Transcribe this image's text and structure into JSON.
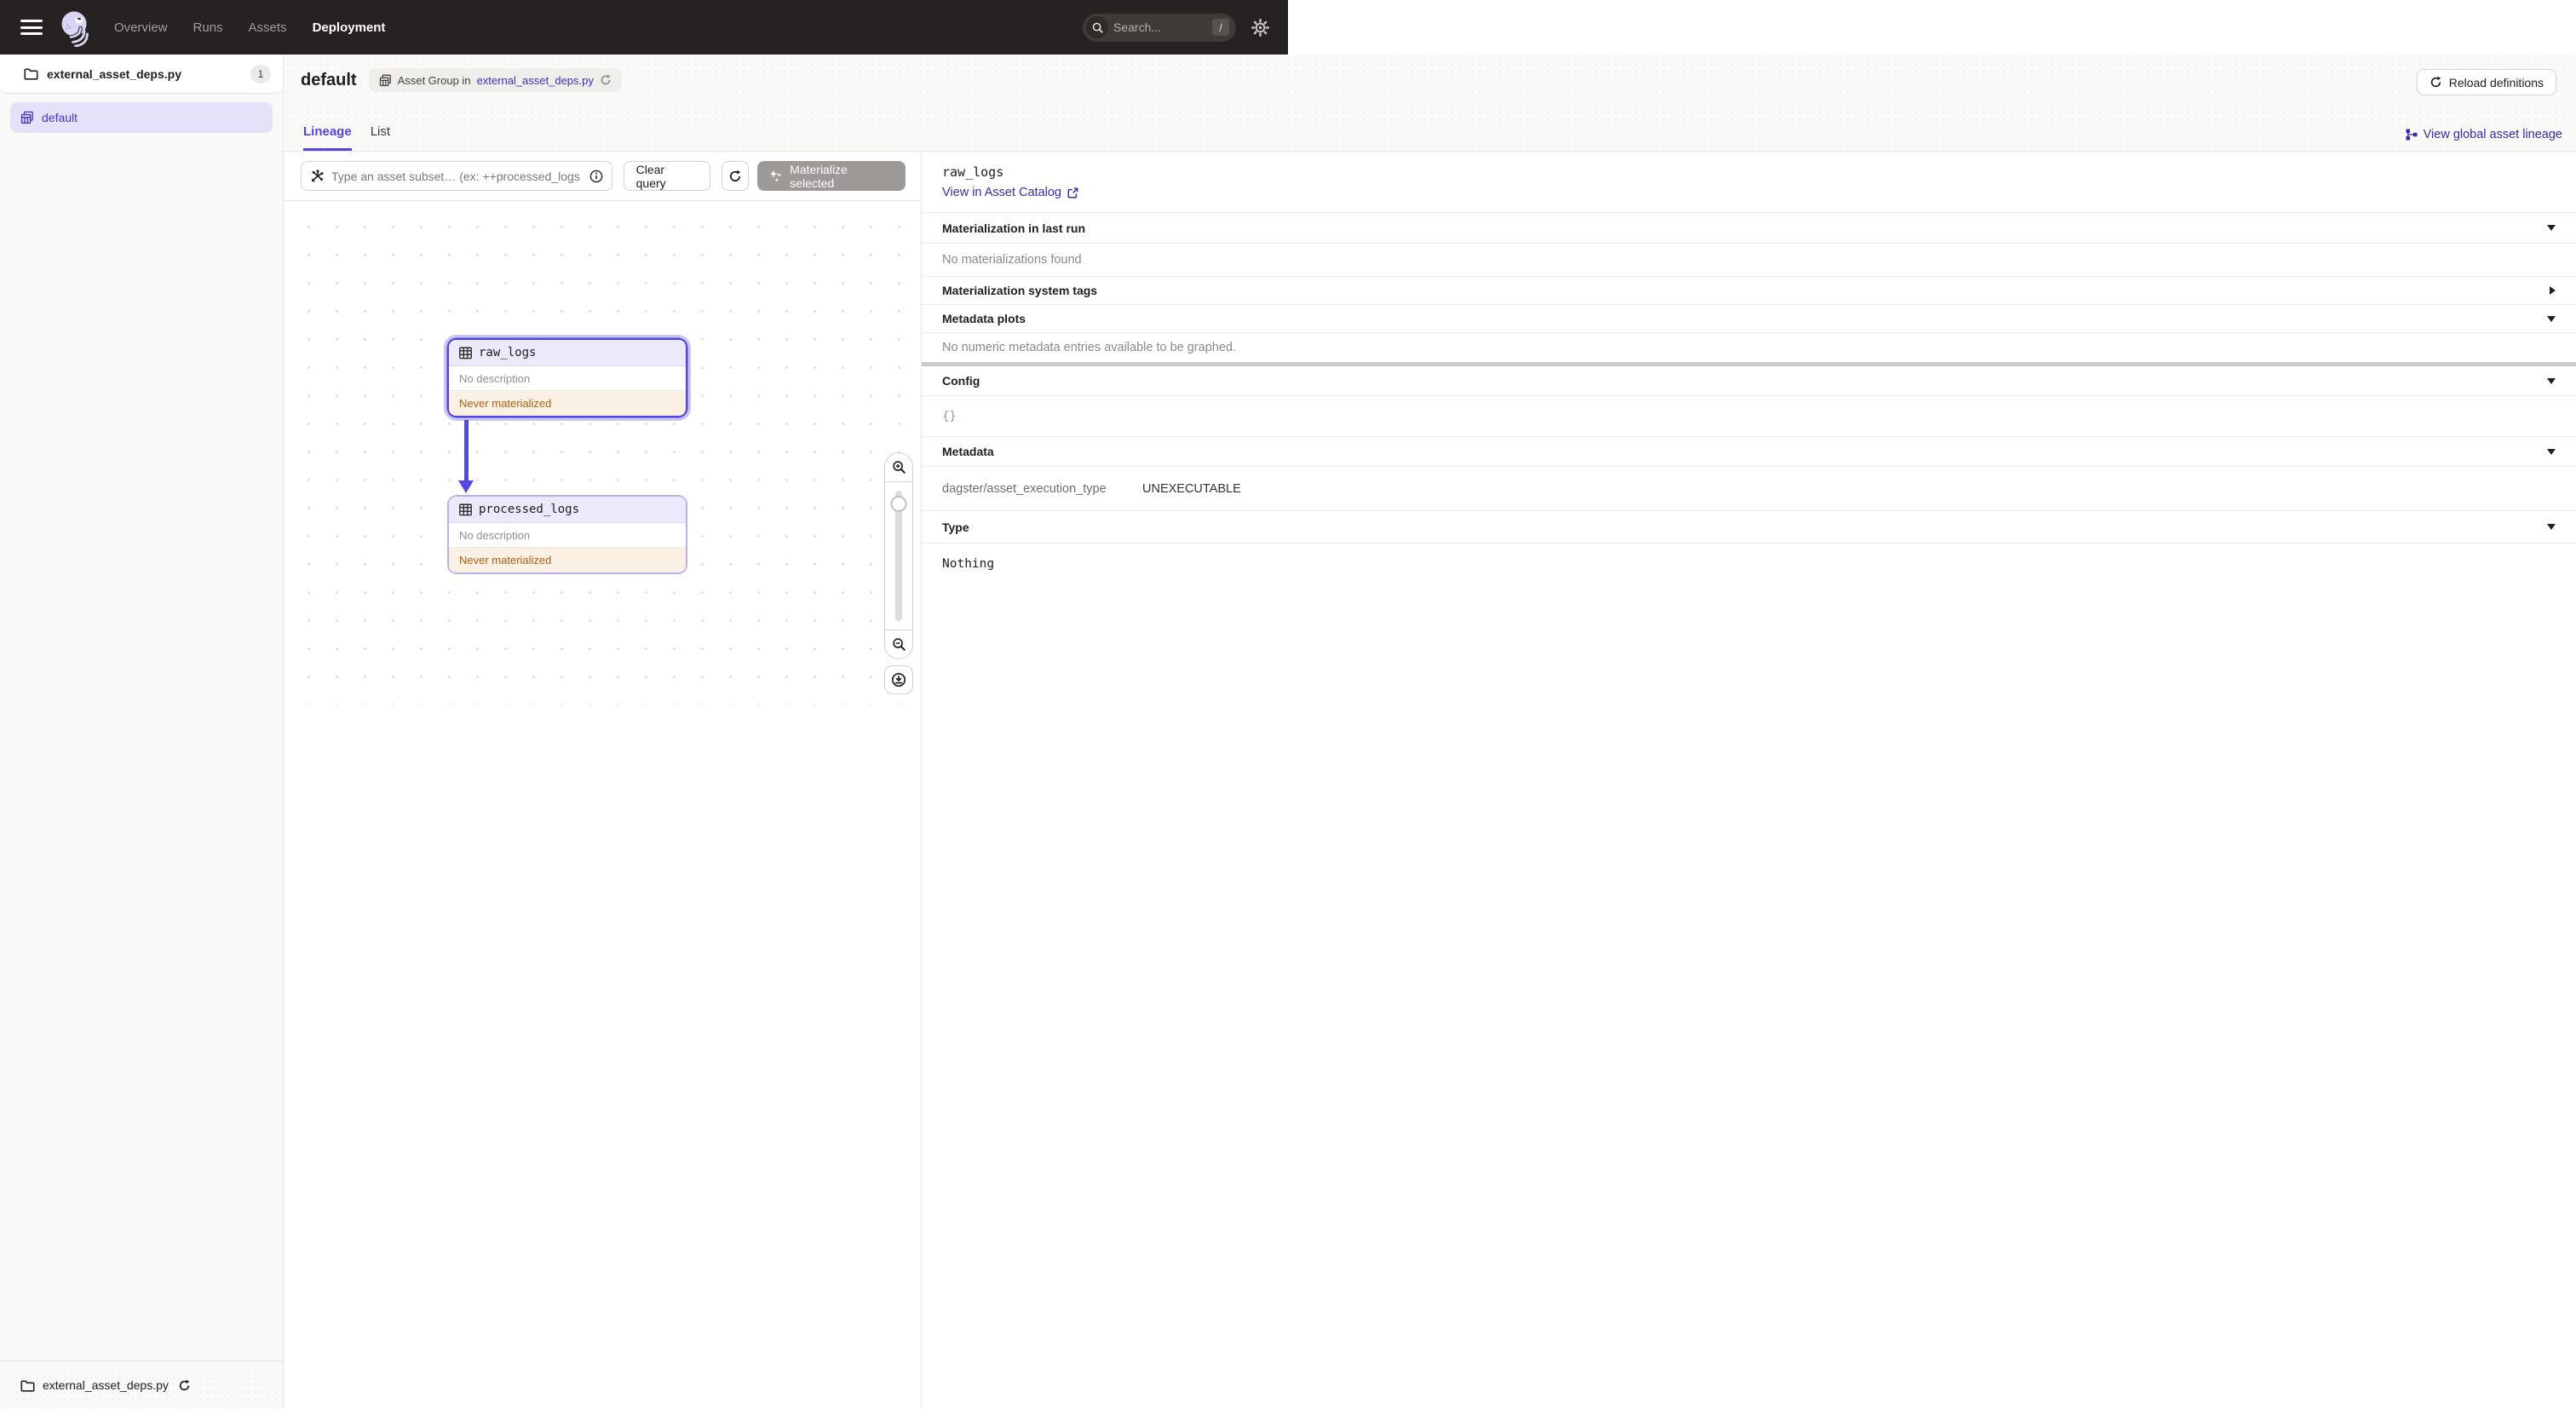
{
  "topnav": {
    "nav_items": [
      {
        "label": "Overview",
        "active": false
      },
      {
        "label": "Runs",
        "active": false
      },
      {
        "label": "Assets",
        "active": false
      },
      {
        "label": "Deployment",
        "active": true
      }
    ],
    "search": {
      "placeholder": "Search...",
      "shortcut": "/"
    }
  },
  "sidebar": {
    "module": {
      "label": "external_asset_deps.py",
      "count": "1"
    },
    "selected_group": {
      "label": "default"
    },
    "footer": {
      "label": "external_asset_deps.py"
    }
  },
  "header": {
    "title": "default",
    "group_pill": {
      "prefix": "Asset Group in",
      "link": "external_asset_deps.py"
    },
    "reload_button": "Reload definitions",
    "tabs": [
      {
        "label": "Lineage",
        "active": true
      },
      {
        "label": "List",
        "active": false
      }
    ],
    "global_lineage_link": "View global asset lineage"
  },
  "toolbar": {
    "query_placeholder": "Type an asset subset… (ex: ++processed_logs",
    "clear_button": "Clear query",
    "materialize_button": "Materialize selected"
  },
  "graph": {
    "nodes": [
      {
        "name": "raw_logs",
        "description": "No description",
        "status": "Never materialized",
        "selected": true
      },
      {
        "name": "processed_logs",
        "description": "No description",
        "status": "Never materialized",
        "selected": false
      }
    ]
  },
  "panel": {
    "title": "raw_logs",
    "catalog_link": "View in Asset Catalog",
    "sections": {
      "last_run": {
        "label": "Materialization in last run",
        "empty": "No materializations found"
      },
      "system_tags": {
        "label": "Materialization system tags"
      },
      "metadata_plots": {
        "label": "Metadata plots",
        "empty": "No numeric metadata entries available to be graphed."
      },
      "config": {
        "label": "Config",
        "value": "{}"
      },
      "metadata": {
        "label": "Metadata",
        "row_key": "dagster/asset_execution_type",
        "row_value": "UNEXECUTABLE"
      },
      "type": {
        "label": "Type",
        "value": "Nothing"
      }
    }
  },
  "colors": {
    "accent": "#5045E0",
    "selection_border": "#5145E3",
    "link": "#332DA9",
    "warning_text": "#AD5F14",
    "warning_bg": "#FAF0E3",
    "topnav_bg": "#262221",
    "node_header_bg": "#ECEAFA"
  }
}
